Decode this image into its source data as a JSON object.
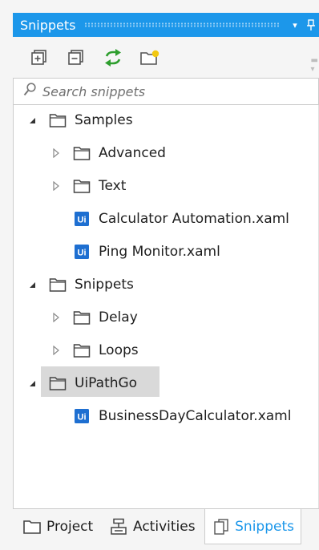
{
  "panel": {
    "title": "Snippets",
    "header_buttons": [
      {
        "name": "dropdown-icon",
        "glyph": "▾"
      },
      {
        "name": "pin-icon",
        "glyph": "ᚨ"
      }
    ],
    "accent_color": "#1c97ea"
  },
  "toolbar": {
    "buttons": [
      {
        "name": "expand-all-icon"
      },
      {
        "name": "collapse-all-icon"
      },
      {
        "name": "refresh-icon"
      },
      {
        "name": "add-folder-icon"
      }
    ]
  },
  "search": {
    "placeholder": "Search snippets",
    "value": ""
  },
  "tree": [
    {
      "label": "Samples",
      "level": 0,
      "type": "folder",
      "expanded": true
    },
    {
      "label": "Advanced",
      "level": 1,
      "type": "folder",
      "expanded": false
    },
    {
      "label": "Text",
      "level": 1,
      "type": "folder",
      "expanded": false
    },
    {
      "label": "Calculator Automation.xaml",
      "level": 1,
      "type": "file"
    },
    {
      "label": "Ping Monitor.xaml",
      "level": 1,
      "type": "file"
    },
    {
      "label": "Snippets",
      "level": 0,
      "type": "folder",
      "expanded": true
    },
    {
      "label": "Delay",
      "level": 1,
      "type": "folder",
      "expanded": false
    },
    {
      "label": "Loops",
      "level": 1,
      "type": "folder",
      "expanded": false
    },
    {
      "label": "UiPathGo",
      "level": 0,
      "type": "folder",
      "expanded": true,
      "selected": true
    },
    {
      "label": "BusinessDayCalculator.xaml",
      "level": 1,
      "type": "file"
    }
  ],
  "file_icon_text": "Ui",
  "tabs": [
    {
      "label": "Project",
      "icon": "folder-icon",
      "active": false
    },
    {
      "label": "Activities",
      "icon": "activities-icon",
      "active": false
    },
    {
      "label": "Snippets",
      "icon": "snippets-icon",
      "active": true
    }
  ]
}
